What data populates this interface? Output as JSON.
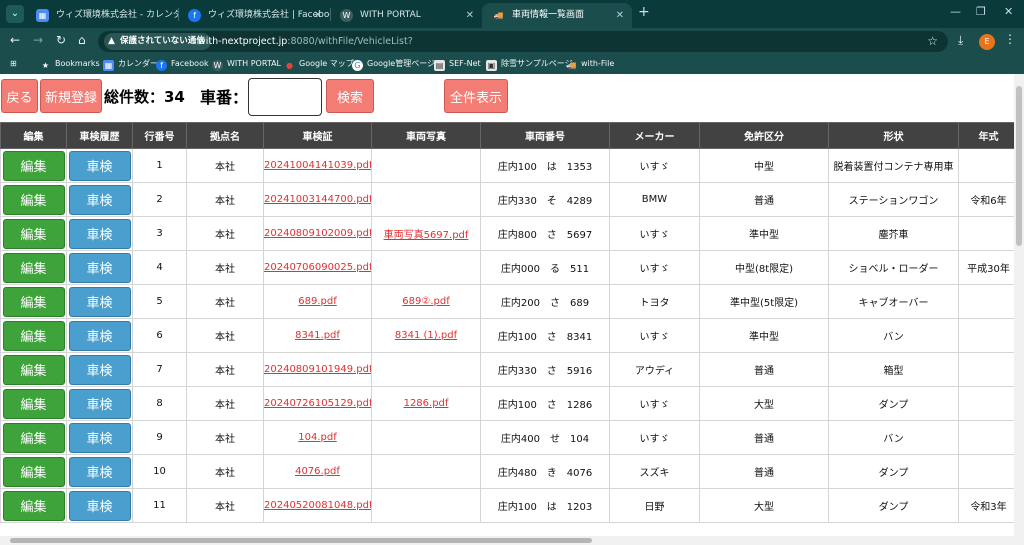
{
  "browser": {
    "tabs": [
      {
        "title": "ウィズ環境株式会社 - カレンダー - ",
        "active": false
      },
      {
        "title": "ウィズ環境株式会社 | Facebook",
        "active": false
      },
      {
        "title": "WITH PORTAL",
        "active": false
      },
      {
        "title": "車両情報一覧画面",
        "active": true
      }
    ],
    "security_chip": "保護されていない通信",
    "url_host": "with-nextproject.jp",
    "url_path": ":8080/withFile/VehicleList?",
    "profile_initial": "E",
    "bookmarks": [
      "Bookmarks",
      "カレンダー",
      "Facebook",
      "WITH PORTAL",
      "Google マップ",
      "Google管理ページ",
      "SEF-Net",
      "除雪サンプルページ",
      "with-File"
    ]
  },
  "controls": {
    "back_label": "戻る",
    "new_label": "新規登録",
    "count_label": "総件数：34",
    "plate_label": "車番：",
    "plate_value": "",
    "search_label": "検索",
    "show_all_label": "全件表示"
  },
  "table": {
    "headers": [
      "編集",
      "車検履歴",
      "行番号",
      "拠点名",
      "車検証",
      "車両写真",
      "車両番号",
      "メーカー",
      "免許区分",
      "形状",
      "年式"
    ],
    "edit_label": "編集",
    "inspection_label": "車検",
    "rows": [
      {
        "no": "1",
        "base": "本社",
        "cert": "20241004141039.pdf",
        "photo": "",
        "plate": "庄内100　は　1353",
        "maker": "いすゞ",
        "license": "中型",
        "shape": "脱着装置付コンテナ専用車",
        "year": ""
      },
      {
        "no": "2",
        "base": "本社",
        "cert": "20241003144700.pdf",
        "photo": "",
        "plate": "庄内330　そ　4289",
        "maker": "BMW",
        "license": "普通",
        "shape": "ステーションワゴン",
        "year": "令和6年"
      },
      {
        "no": "3",
        "base": "本社",
        "cert": "20240809102009.pdf",
        "photo": "車両写真5697.pdf",
        "plate": "庄内800　さ　5697",
        "maker": "いすゞ",
        "license": "準中型",
        "shape": "塵芥車",
        "year": ""
      },
      {
        "no": "4",
        "base": "本社",
        "cert": "20240706090025.pdf",
        "photo": "",
        "plate": "庄内000　る　511",
        "maker": "いすゞ",
        "license": "中型(8t限定)",
        "shape": "ショベル・ローダー",
        "year": "平成30年"
      },
      {
        "no": "5",
        "base": "本社",
        "cert": "689.pdf",
        "photo": "689②.pdf",
        "plate": "庄内200　さ　689",
        "maker": "トヨタ",
        "license": "準中型(5t限定)",
        "shape": "キャブオーバー",
        "year": ""
      },
      {
        "no": "6",
        "base": "本社",
        "cert": "8341.pdf",
        "photo": "8341 (1).pdf",
        "plate": "庄内100　さ　8341",
        "maker": "いすゞ",
        "license": "準中型",
        "shape": "バン",
        "year": ""
      },
      {
        "no": "7",
        "base": "本社",
        "cert": "20240809101949.pdf",
        "photo": "",
        "plate": "庄内330　さ　5916",
        "maker": "アウディ",
        "license": "普通",
        "shape": "箱型",
        "year": ""
      },
      {
        "no": "8",
        "base": "本社",
        "cert": "20240726105129.pdf",
        "photo": "1286.pdf",
        "plate": "庄内100　さ　1286",
        "maker": "いすゞ",
        "license": "大型",
        "shape": "ダンプ",
        "year": ""
      },
      {
        "no": "9",
        "base": "本社",
        "cert": "104.pdf",
        "photo": "",
        "plate": "庄内400　せ　104",
        "maker": "いすゞ",
        "license": "普通",
        "shape": "バン",
        "year": ""
      },
      {
        "no": "10",
        "base": "本社",
        "cert": "4076.pdf",
        "photo": "",
        "plate": "庄内480　き　4076",
        "maker": "スズキ",
        "license": "普通",
        "shape": "ダンプ",
        "year": ""
      },
      {
        "no": "11",
        "base": "本社",
        "cert": "20240520081048.pdf",
        "photo": "",
        "plate": "庄内100　は　1203",
        "maker": "日野",
        "license": "大型",
        "shape": "ダンプ",
        "year": "令和3年"
      }
    ]
  }
}
